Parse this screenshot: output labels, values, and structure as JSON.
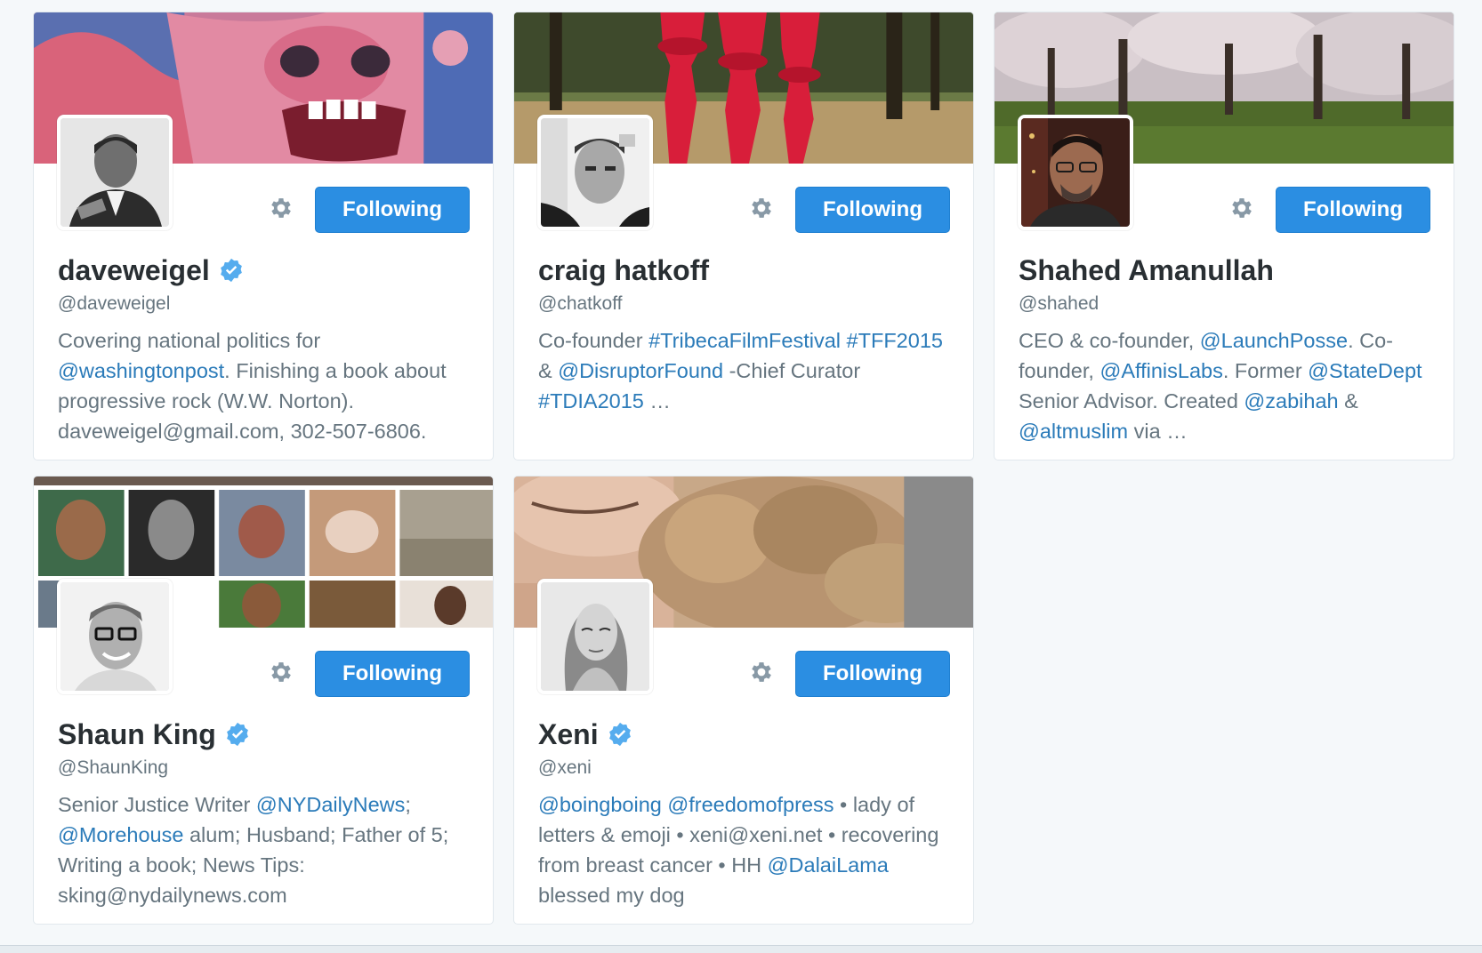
{
  "cards": [
    {
      "name": "daveweigel",
      "handle": "@daveweigel",
      "verified": true,
      "follow_label": "Following",
      "bio": [
        {
          "t": "Covering national politics for "
        },
        {
          "t": "@washingtonpost",
          "link": true
        },
        {
          "t": ". Finishing a book about progressive rock (W.W. Norton). daveweigel@gmail.com, 302-507-6806."
        }
      ]
    },
    {
      "name": "craig hatkoff",
      "handle": "@chatkoff",
      "verified": false,
      "follow_label": "Following",
      "bio": [
        {
          "t": "Co-founder "
        },
        {
          "t": "#TribecaFilmFestival",
          "link": true
        },
        {
          "t": " "
        },
        {
          "t": "#TFF2015",
          "link": true
        },
        {
          "t": " & "
        },
        {
          "t": "@DisruptorFound",
          "link": true
        },
        {
          "t": " -Chief Curator "
        },
        {
          "t": "#TDIA2015",
          "link": true
        },
        {
          "t": " …"
        }
      ]
    },
    {
      "name": "Shahed Amanullah",
      "handle": "@shahed",
      "verified": false,
      "follow_label": "Following",
      "bio": [
        {
          "t": "CEO & co-founder, "
        },
        {
          "t": "@LaunchPosse",
          "link": true
        },
        {
          "t": ". Co-founder, "
        },
        {
          "t": "@AffinisLabs",
          "link": true
        },
        {
          "t": ". Former "
        },
        {
          "t": "@StateDept",
          "link": true
        },
        {
          "t": " Senior Advisor. Created "
        },
        {
          "t": "@zabihah",
          "link": true
        },
        {
          "t": " & "
        },
        {
          "t": "@altmuslim",
          "link": true
        },
        {
          "t": " via …"
        }
      ]
    },
    {
      "name": "Shaun King",
      "handle": "@ShaunKing",
      "verified": true,
      "follow_label": "Following",
      "bio": [
        {
          "t": "Senior Justice Writer "
        },
        {
          "t": "@NYDailyNews",
          "link": true
        },
        {
          "t": "; "
        },
        {
          "t": "@Morehouse",
          "link": true
        },
        {
          "t": " alum; Husband; Father of 5; Writing a book; News Tips: sking@nydailynews.com"
        }
      ]
    },
    {
      "name": "Xeni",
      "handle": "@xeni",
      "verified": true,
      "follow_label": "Following",
      "bio": [
        {
          "t": "@boingboing",
          "link": true
        },
        {
          "t": " "
        },
        {
          "t": "@freedomofpress",
          "link": true
        },
        {
          "t": " • lady of letters & emoji • xeni@xeni.net • recovering from breast cancer • HH "
        },
        {
          "t": "@DalaiLama",
          "link": true
        },
        {
          "t": " blessed my dog"
        }
      ]
    }
  ],
  "icons": {
    "settings": "gear-icon",
    "verified": "verified-badge-icon"
  },
  "colors": {
    "follow_button": "#2b8ee2",
    "link": "#2b7bb9",
    "verified": "#55acee",
    "name_text": "#292f33",
    "muted_text": "#66757f"
  }
}
